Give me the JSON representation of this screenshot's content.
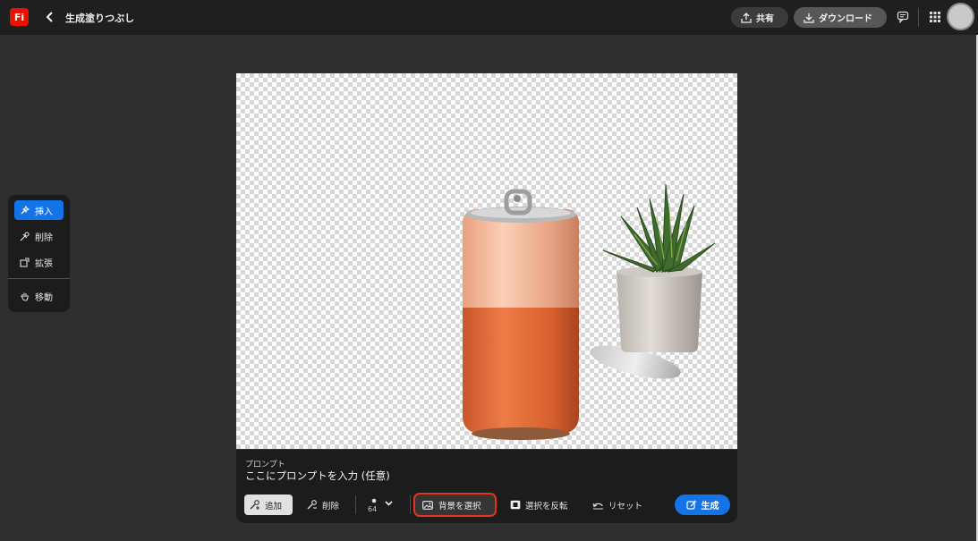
{
  "header": {
    "logo": "Fi",
    "back_icon": "chevron-left-icon",
    "title": "生成塗りつぶし",
    "share_label": "共有",
    "download_label": "ダウンロード"
  },
  "tools": {
    "insert": "挿入",
    "remove": "削除",
    "expand": "拡張",
    "move": "移動"
  },
  "prompt": {
    "label": "プロンプト",
    "placeholder": "ここにプロンプトを入力 (任意)",
    "add_label": "追加",
    "delete_label": "削除",
    "brush_size": "64",
    "select_bg_label": "背景を選択",
    "invert_label": "選択を反転",
    "reset_label": "リセット",
    "generate_label": "生成"
  },
  "colors": {
    "accent": "#1473e6",
    "highlight": "#e8321a",
    "brand": "#eb1000"
  }
}
